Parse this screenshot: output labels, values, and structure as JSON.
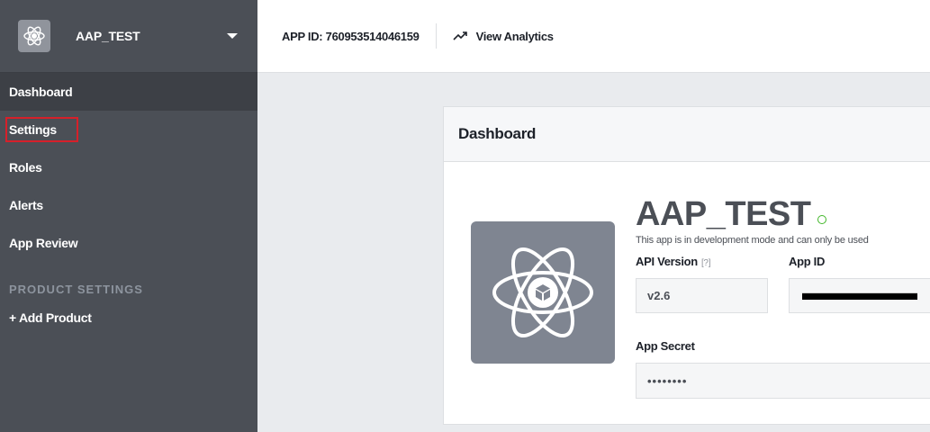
{
  "sidebar": {
    "app_name": "AAP_TEST",
    "items": [
      {
        "label": "Dashboard"
      },
      {
        "label": "Settings"
      },
      {
        "label": "Roles"
      },
      {
        "label": "Alerts"
      },
      {
        "label": "App Review"
      }
    ],
    "section_header": "PRODUCT SETTINGS",
    "add_product": "+ Add Product"
  },
  "topbar": {
    "app_id": "APP ID: 760953514046159",
    "view_analytics": "View Analytics"
  },
  "card": {
    "title": "Dashboard",
    "app_title": "AAP_TEST",
    "description": "This app is in development mode and can only be used",
    "api_version_label": "API Version",
    "api_version_help": "[?]",
    "api_version_value": "v2.6",
    "app_id_label": "App ID",
    "app_secret_label": "App Secret",
    "app_secret_value": "••••••••"
  },
  "colors": {
    "sidebar_bg": "#4b4f56",
    "highlight_border": "#d6202a",
    "status_green": "#42b72a"
  }
}
